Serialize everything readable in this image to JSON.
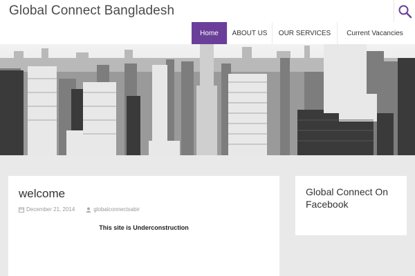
{
  "site": {
    "title": "Global Connect Bangladesh"
  },
  "nav": {
    "items": [
      {
        "label": "Home"
      },
      {
        "label": "ABOUT US"
      },
      {
        "label": "OUR SERVICES"
      },
      {
        "label": "Current Vacancies"
      }
    ],
    "active_color": "#6a3f9a"
  },
  "search": {
    "icon": "search-icon"
  },
  "post": {
    "title": "welcome",
    "date": "December 21, 2014",
    "author": "globalconnectsabir",
    "body": "This site is Underconstruction"
  },
  "sidebar": {
    "widget_title": "Global Connect On Facebook"
  }
}
